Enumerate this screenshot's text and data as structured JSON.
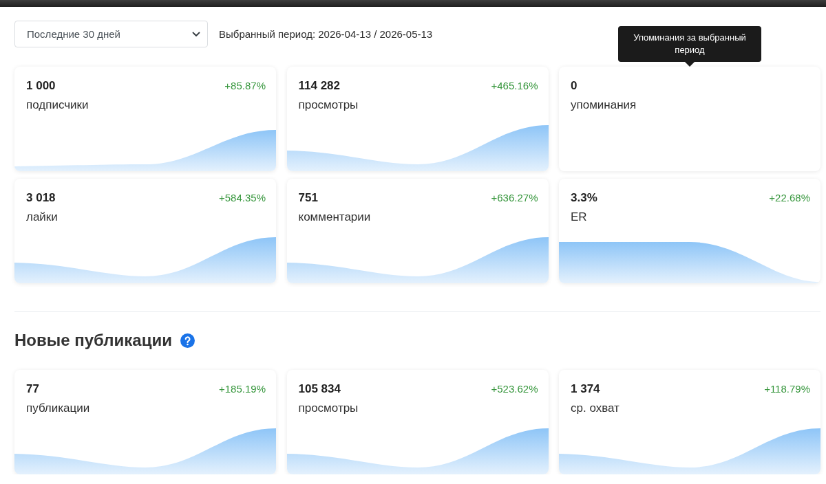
{
  "period_select": {
    "value": "Последние 30 дней"
  },
  "period_label": "Выбранный период: 2026-04-13 / 2026-05-13",
  "summary": {
    "cards": [
      {
        "value": "1 000",
        "label": "подписчики",
        "change": "+85.87%",
        "kind": "rise"
      },
      {
        "value": "114 282",
        "label": "просмотры",
        "change": "+465.16%",
        "kind": "rebound"
      },
      {
        "value": "0",
        "label": "упоминания",
        "kind": "blank",
        "tooltip": "Упоминания за выбранный период"
      },
      {
        "value": "3 018",
        "label": "лайки",
        "change": "+584.35%",
        "kind": "rebound"
      },
      {
        "value": "751",
        "label": "комментарии",
        "change": "+636.27%",
        "kind": "rebound"
      },
      {
        "value": "3.3%",
        "label": "ER",
        "change": "+22.68%",
        "kind": "decline"
      }
    ]
  },
  "new_publications": {
    "title": "Новые публикации",
    "cards": [
      {
        "value": "77",
        "label": "публикации",
        "change": "+185.19%",
        "kind": "rebound"
      },
      {
        "value": "105 834",
        "label": "просмотры",
        "change": "+523.62%",
        "kind": "rebound"
      },
      {
        "value": "1 374",
        "label": "ср. охват",
        "change": "+118.79%",
        "kind": "rebound"
      }
    ]
  }
}
